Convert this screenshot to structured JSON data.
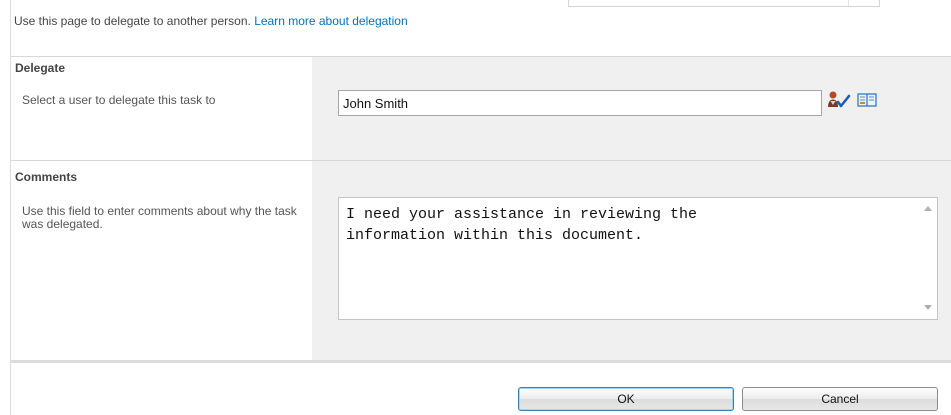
{
  "intro": {
    "text": "Use this page to delegate to another person.",
    "link_label": "Learn more about delegation"
  },
  "delegate": {
    "title": "Delegate",
    "description": "Select a user to delegate this task to",
    "value": "John Smith",
    "check_names_icon": "check-names-icon",
    "browse_icon": "address-book-icon"
  },
  "comments": {
    "title": "Comments",
    "description": "Use this field to enter comments about why the task was delegated.",
    "value": "I need your assistance in reviewing the\ninformation within this document."
  },
  "buttons": {
    "ok_label": "OK",
    "cancel_label": "Cancel"
  },
  "colors": {
    "link": "#0072bc",
    "section_bg": "#f0f0f0",
    "ok_border": "#3c7fb1"
  }
}
